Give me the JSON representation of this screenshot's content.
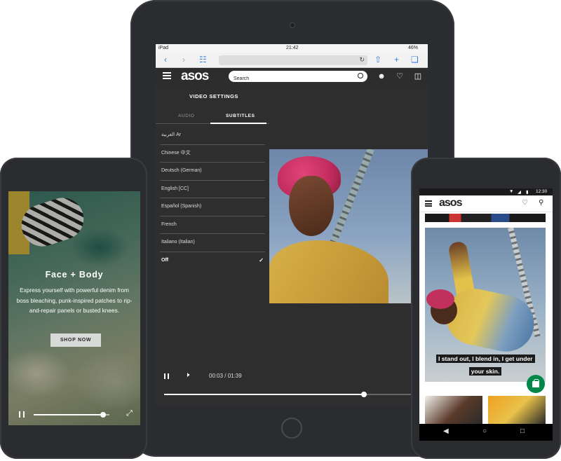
{
  "tablet": {
    "status": {
      "carrier": "iPad",
      "time": "21:42",
      "battery": "46%"
    },
    "header": {
      "logo": "asos",
      "search_placeholder": "Search"
    },
    "video_settings": {
      "title": "VIDEO SETTINGS",
      "tabs": [
        "AUDIO",
        "SUBTITLES"
      ],
      "active_tab": "SUBTITLES",
      "subtitles": [
        "العربية Ar",
        "Chinese 中文",
        "Deutsch (German)",
        "English [CC]",
        "Español (Spanish)",
        "French",
        "Italiano (Italian)",
        "Off"
      ],
      "selected": "Off"
    },
    "player": {
      "time": "00:03 / 01:39",
      "progress": 0.77
    }
  },
  "phone_left": {
    "title": "Face + Body",
    "description": "Express yourself with powerful denim from boss bleaching, punk-inspired patches to rip-and-repair panels or busted knees.",
    "cta": "SHOP NOW",
    "progress": 0.92
  },
  "phone_right": {
    "status_time": "12:30",
    "logo": "asos",
    "caption": "I stand out, I blend in, I get under your skin.",
    "accent_color": "#018849"
  }
}
